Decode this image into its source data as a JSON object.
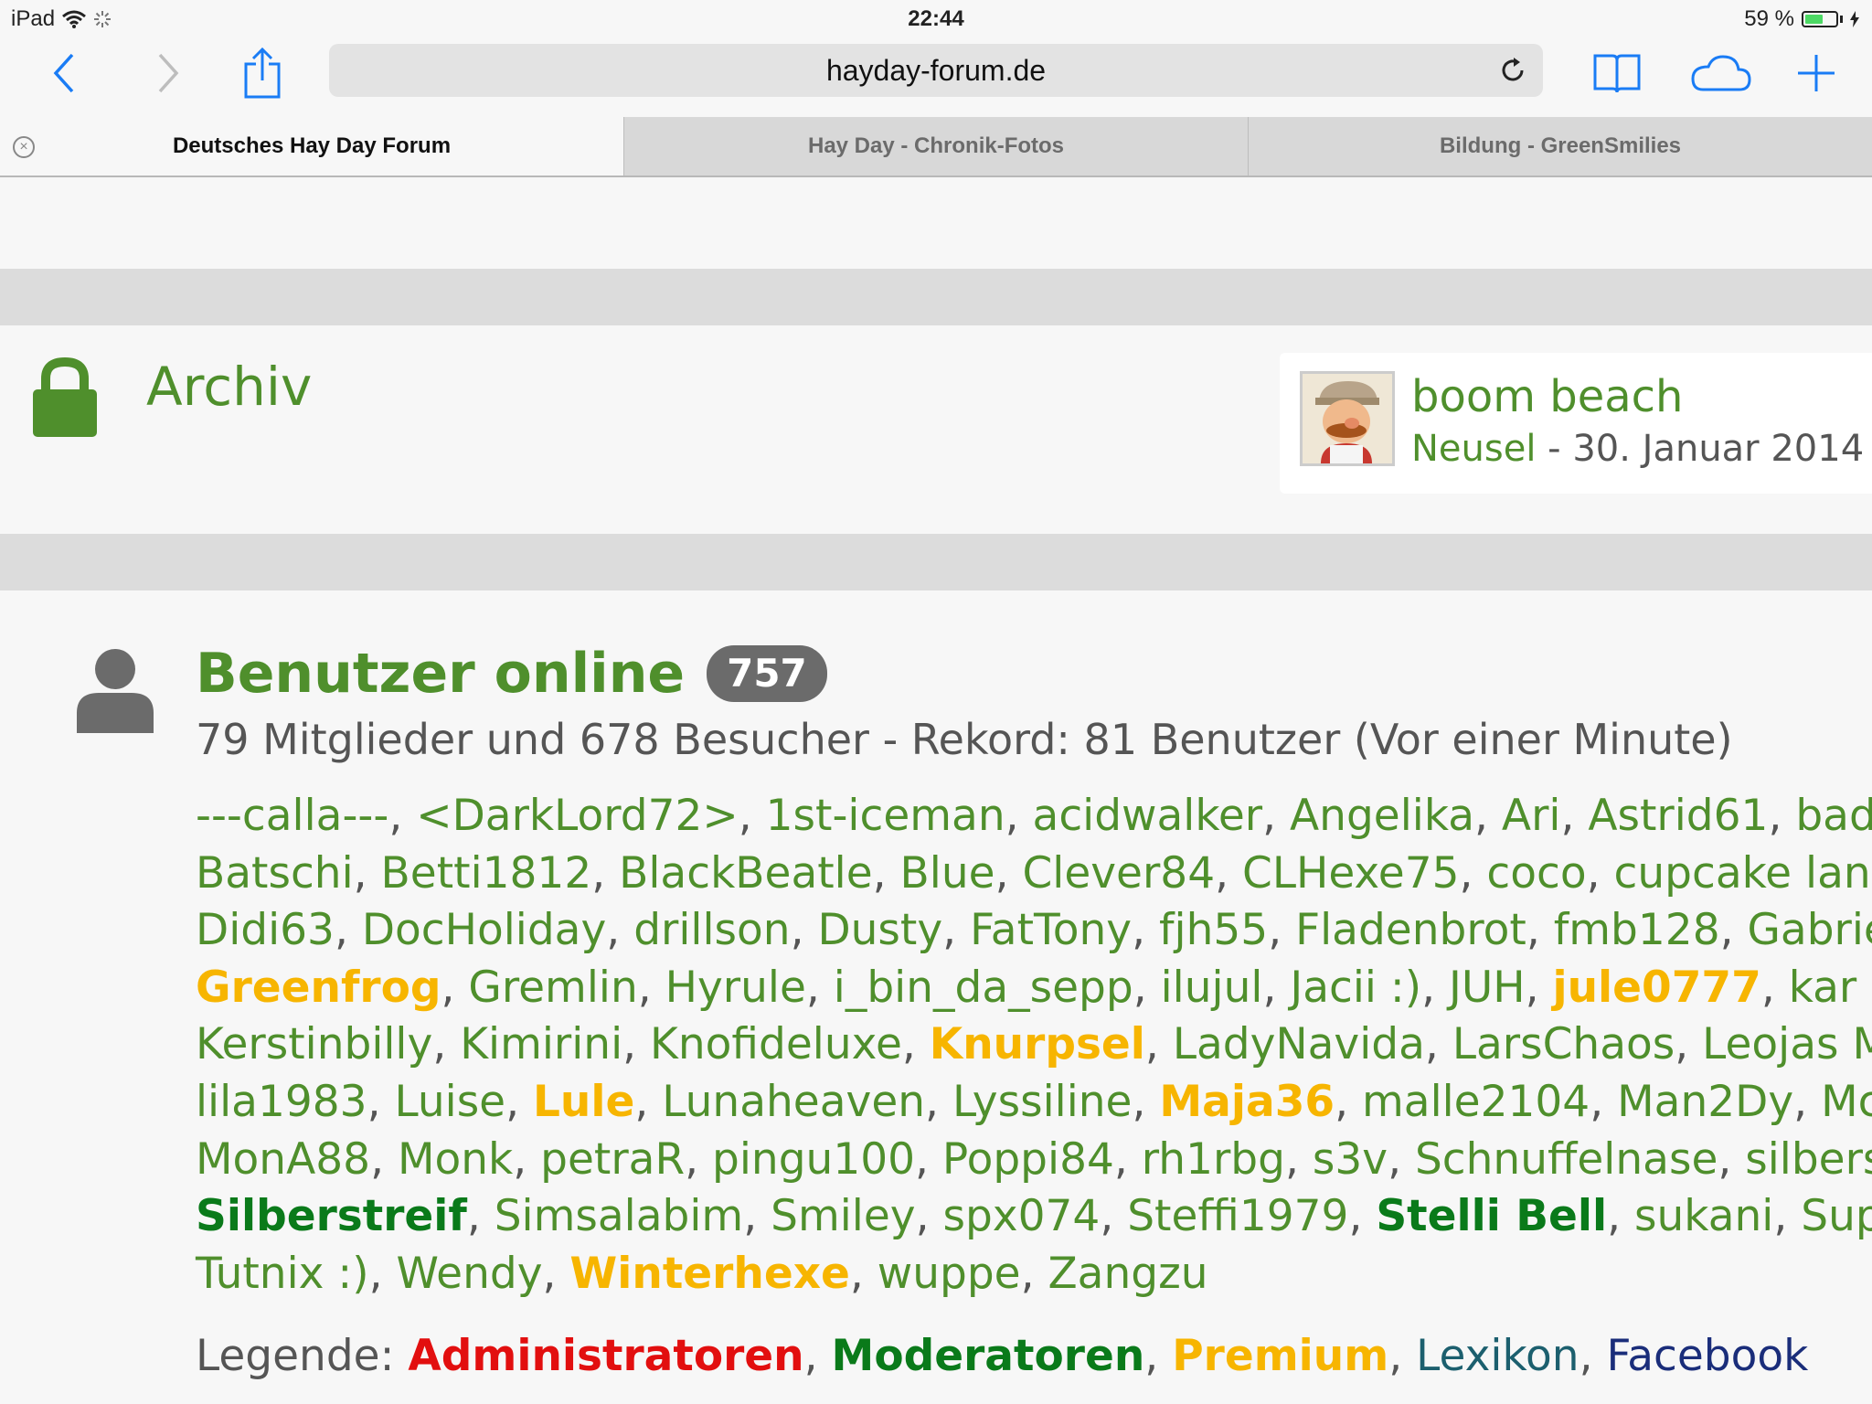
{
  "status_bar": {
    "device": "iPad",
    "time": "22:44",
    "battery": "59 %",
    "battery_level": 0.59
  },
  "toolbar": {
    "url": "hayday-forum.de"
  },
  "tabs": [
    {
      "label": "Deutsches Hay Day Forum",
      "active": true
    },
    {
      "label": "Hay Day - Chronik-Fotos",
      "active": false
    },
    {
      "label": "Bildung - GreenSmilies",
      "active": false
    }
  ],
  "archive": {
    "title": "Archiv",
    "last_post": {
      "title": "boom beach",
      "author": "Neusel",
      "separator": " - ",
      "date": "30. Januar 2014"
    }
  },
  "online": {
    "title": "Benutzer online",
    "count": "757",
    "subtitle": "79 Mitglieder und 678 Besucher - Rekord: 81 Benutzer (Vor einer Minute)",
    "lines": [
      [
        {
          "n": "---calla---",
          "t": "u"
        },
        {
          "n": "<DarkLord72>",
          "t": "u"
        },
        {
          "n": "1st-iceman",
          "t": "u"
        },
        {
          "n": "acidwalker",
          "t": "u"
        },
        {
          "n": "Angelika",
          "t": "u"
        },
        {
          "n": "Ari",
          "t": "u"
        },
        {
          "n": "Astrid61",
          "t": "u"
        },
        {
          "n": "badu",
          "t": "u",
          "cut": true
        }
      ],
      [
        {
          "n": "Batschi",
          "t": "u"
        },
        {
          "n": "Betti1812",
          "t": "u"
        },
        {
          "n": "BlackBeatle",
          "t": "u"
        },
        {
          "n": "Blue",
          "t": "u"
        },
        {
          "n": "Clever84",
          "t": "u"
        },
        {
          "n": "CLHexe75",
          "t": "u"
        },
        {
          "n": "coco",
          "t": "u"
        },
        {
          "n": "cupcake land",
          "t": "u"
        }
      ],
      [
        {
          "n": "Didi63",
          "t": "u"
        },
        {
          "n": "DocHoliday",
          "t": "u"
        },
        {
          "n": "drillson",
          "t": "u"
        },
        {
          "n": "Dusty",
          "t": "u"
        },
        {
          "n": "FatTony",
          "t": "u"
        },
        {
          "n": "fjh55",
          "t": "u"
        },
        {
          "n": "Fladenbrot",
          "t": "u"
        },
        {
          "n": "fmb128",
          "t": "u"
        },
        {
          "n": "Gabrie",
          "t": "u",
          "cut": true
        }
      ],
      [
        {
          "n": "Greenfrog",
          "t": "prem"
        },
        {
          "n": "Gremlin",
          "t": "u"
        },
        {
          "n": "Hyrule",
          "t": "u"
        },
        {
          "n": "i_bin_da_sepp",
          "t": "u"
        },
        {
          "n": "ilujul",
          "t": "u"
        },
        {
          "n": "Jacii :)",
          "t": "u"
        },
        {
          "n": "JUH",
          "t": "u"
        },
        {
          "n": "jule0777",
          "t": "prem"
        },
        {
          "n": "kar",
          "t": "u",
          "cut": true
        }
      ],
      [
        {
          "n": "Kerstinbilly",
          "t": "u"
        },
        {
          "n": "Kimirini",
          "t": "u"
        },
        {
          "n": "Knofideluxe",
          "t": "u"
        },
        {
          "n": "Knurpsel",
          "t": "prem"
        },
        {
          "n": "LadyNavida",
          "t": "u"
        },
        {
          "n": "LarsChaos",
          "t": "u"
        },
        {
          "n": "Leojas Mo",
          "t": "u",
          "cut": true
        }
      ],
      [
        {
          "n": "lila1983",
          "t": "u"
        },
        {
          "n": "Luise",
          "t": "u"
        },
        {
          "n": "Lule",
          "t": "prem"
        },
        {
          "n": "Lunaheaven",
          "t": "u"
        },
        {
          "n": "Lyssiline",
          "t": "u"
        },
        {
          "n": "Maja36",
          "t": "prem"
        },
        {
          "n": "malle2104",
          "t": "u"
        },
        {
          "n": "Man2Dy",
          "t": "u"
        },
        {
          "n": "McInt",
          "t": "u",
          "cut": true
        }
      ],
      [
        {
          "n": "MonA88",
          "t": "u"
        },
        {
          "n": "Monk",
          "t": "u"
        },
        {
          "n": "petraR",
          "t": "u"
        },
        {
          "n": "pingu100",
          "t": "u"
        },
        {
          "n": "Poppi84",
          "t": "u"
        },
        {
          "n": "rh1rbg",
          "t": "u"
        },
        {
          "n": "s3v",
          "t": "u"
        },
        {
          "n": "Schnuffelnase",
          "t": "u"
        },
        {
          "n": "silberste",
          "t": "u",
          "cut": true
        }
      ],
      [
        {
          "n": "Silberstreif",
          "t": "mod"
        },
        {
          "n": "Simsalabim",
          "t": "u"
        },
        {
          "n": "Smiley",
          "t": "u"
        },
        {
          "n": "spx074",
          "t": "u"
        },
        {
          "n": "Steffi1979",
          "t": "u"
        },
        {
          "n": "Stelli Bell",
          "t": "mod"
        },
        {
          "n": "sukani",
          "t": "u"
        },
        {
          "n": "Superd",
          "t": "u",
          "cut": true
        }
      ],
      [
        {
          "n": "Tutnix :)",
          "t": "u"
        },
        {
          "n": "Wendy",
          "t": "u"
        },
        {
          "n": "Winterhexe",
          "t": "prem"
        },
        {
          "n": "wuppe",
          "t": "u"
        },
        {
          "n": "Zangzu",
          "t": "u",
          "last": true
        }
      ]
    ]
  },
  "legend": {
    "label": "Legende:",
    "items": [
      {
        "label": "Administratoren",
        "cls": "lg-admin"
      },
      {
        "label": "Moderatoren",
        "cls": "lg-mod"
      },
      {
        "label": "Premium",
        "cls": "lg-prem"
      },
      {
        "label": "Lexikon",
        "cls": "lg-lex"
      },
      {
        "label": "Facebook",
        "cls": "lg-fb"
      }
    ]
  },
  "colors": {
    "green": "#4f8f2c",
    "premium": "#f7b500",
    "moderator": "#0a7a1a",
    "admin": "#e20f0f",
    "lexikon": "#1c5f6e",
    "facebook": "#1a2d7a",
    "ios_blue": "#1a7cf5"
  }
}
